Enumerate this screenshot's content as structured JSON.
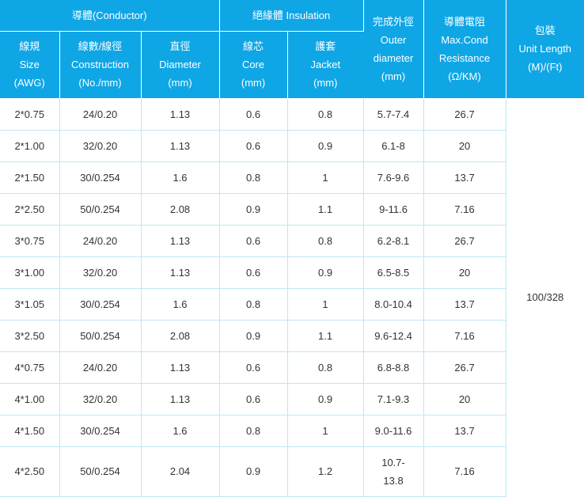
{
  "header": {
    "conductor_group": "導體(Conductor)",
    "insulation_group": "絕緣體 Insulation",
    "gauge": [
      "線規",
      "Size",
      "(AWG)"
    ],
    "construction": [
      "線數/線徑",
      "Construction",
      "(No./mm)"
    ],
    "diameter": [
      "直徑",
      "Diameter",
      "(mm)"
    ],
    "core": [
      "線芯",
      "Core",
      "(mm)"
    ],
    "jacket": [
      "護套",
      "Jacket",
      "(mm)"
    ],
    "outer": [
      "完成外徑",
      "Outer",
      "diameter",
      "(mm)"
    ],
    "resistance": [
      "導體電阻",
      "Max.Cond",
      "Resistance",
      "(Ω/KM)"
    ],
    "unit": [
      "包裝",
      "Unit Length",
      "(M)/(Ft)"
    ]
  },
  "unit_length": "100/328",
  "rows": [
    {
      "size": "2*0.75",
      "construction": "24/0.20",
      "diameter": "1.13",
      "core": "0.6",
      "jacket": "0.8",
      "outer": [
        "5.7-7.4"
      ],
      "resistance": "26.7"
    },
    {
      "size": "2*1.00",
      "construction": "32/0.20",
      "diameter": "1.13",
      "core": "0.6",
      "jacket": "0.9",
      "outer": [
        "6.1-8"
      ],
      "resistance": "20"
    },
    {
      "size": "2*1.50",
      "construction": "30/0.254",
      "diameter": "1.6",
      "core": "0.8",
      "jacket": "1",
      "outer": [
        "7.6-9.6"
      ],
      "resistance": "13.7"
    },
    {
      "size": "2*2.50",
      "construction": "50/0.254",
      "diameter": "2.08",
      "core": "0.9",
      "jacket": "1.1",
      "outer": [
        "9-11.6"
      ],
      "resistance": "7.16"
    },
    {
      "size": "3*0.75",
      "construction": "24/0.20",
      "diameter": "1.13",
      "core": "0.6",
      "jacket": "0.8",
      "outer": [
        "6.2-8.1"
      ],
      "resistance": "26.7"
    },
    {
      "size": "3*1.00",
      "construction": "32/0.20",
      "diameter": "1.13",
      "core": "0.6",
      "jacket": "0.9",
      "outer": [
        "6.5-8.5"
      ],
      "resistance": "20"
    },
    {
      "size": "3*1.05",
      "construction": "30/0.254",
      "diameter": "1.6",
      "core": "0.8",
      "jacket": "1",
      "outer": [
        "8.0-10.4"
      ],
      "resistance": "13.7"
    },
    {
      "size": "3*2.50",
      "construction": "50/0.254",
      "diameter": "2.08",
      "core": "0.9",
      "jacket": "1.1",
      "outer": [
        "9.6-12.4"
      ],
      "resistance": "7.16"
    },
    {
      "size": "4*0.75",
      "construction": "24/0.20",
      "diameter": "1.13",
      "core": "0.6",
      "jacket": "0.8",
      "outer": [
        "6.8-8.8"
      ],
      "resistance": "26.7"
    },
    {
      "size": "4*1.00",
      "construction": "32/0.20",
      "diameter": "1.13",
      "core": "0.6",
      "jacket": "0.9",
      "outer": [
        "7.1-9.3"
      ],
      "resistance": "20"
    },
    {
      "size": "4*1.50",
      "construction": "30/0.254",
      "diameter": "1.6",
      "core": "0.8",
      "jacket": "1",
      "outer": [
        "9.0-11.6"
      ],
      "resistance": "13.7"
    },
    {
      "size": "4*2.50",
      "construction": "50/0.254",
      "diameter": "2.04",
      "core": "0.9",
      "jacket": "1.2",
      "outer": [
        "10.7-",
        "13.8"
      ],
      "resistance": "7.16"
    }
  ]
}
